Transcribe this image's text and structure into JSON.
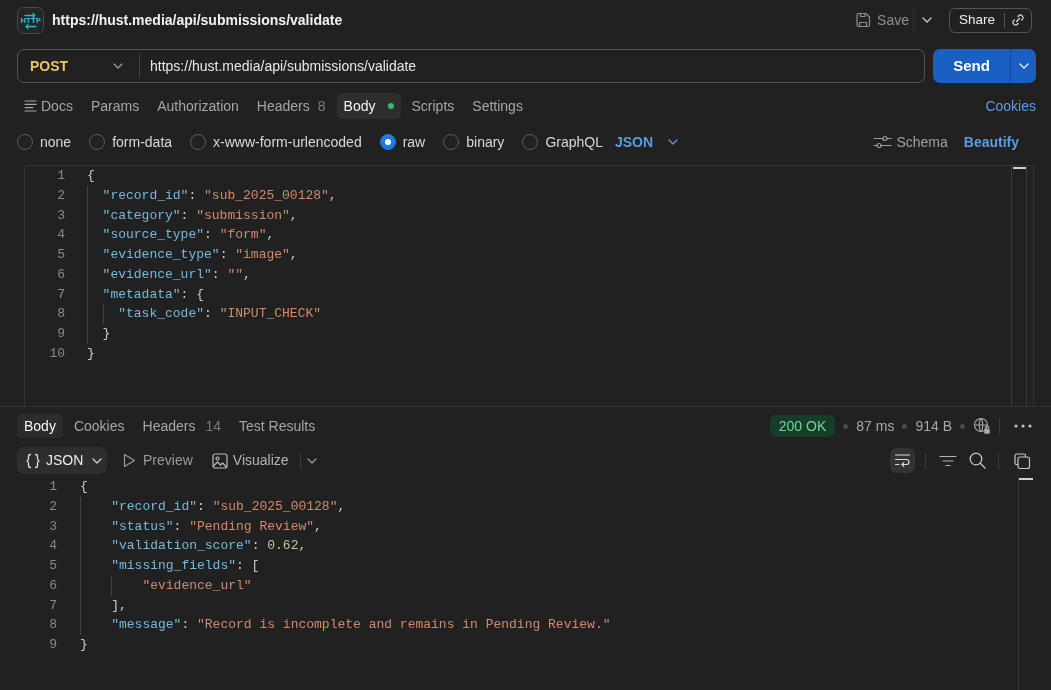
{
  "title_bar": {
    "icon_label": "HTTP",
    "title": "https://hust.media/api/submissions/validate",
    "save_label": "Save",
    "share_label": "Share"
  },
  "request": {
    "method": "POST",
    "url": "https://hust.media/api/submissions/validate",
    "send_label": "Send"
  },
  "request_tabs": [
    {
      "label": "Docs",
      "kind": "docs",
      "selected": false,
      "indicator": false
    },
    {
      "label": "Params",
      "kind": "plain",
      "selected": false,
      "indicator": false
    },
    {
      "label": "Authorization",
      "kind": "plain",
      "selected": false,
      "indicator": false
    },
    {
      "label": "Headers",
      "kind": "plain",
      "count": "8",
      "selected": false,
      "indicator": false
    },
    {
      "label": "Body",
      "kind": "plain",
      "selected": true,
      "indicator": true
    },
    {
      "label": "Scripts",
      "kind": "plain",
      "selected": false,
      "indicator": false
    },
    {
      "label": "Settings",
      "kind": "plain",
      "selected": false,
      "indicator": false
    }
  ],
  "cookies_link": "Cookies",
  "body_types": [
    {
      "label": "none",
      "selected": false
    },
    {
      "label": "form-data",
      "selected": false
    },
    {
      "label": "x-www-form-urlencoded",
      "selected": false
    },
    {
      "label": "raw",
      "selected": true
    },
    {
      "label": "binary",
      "selected": false
    },
    {
      "label": "GraphQL",
      "selected": false
    }
  ],
  "body_format": "JSON",
  "schema_label": "Schema",
  "beautify_label": "Beautify",
  "request_body": [
    {
      "number": "1",
      "tokens": [
        {
          "kind": "punct",
          "text": "{"
        }
      ],
      "children": [
        {
          "number": "2",
          "tokens": [
            {
              "kind": "key",
              "text": "\"record_id\""
            },
            {
              "kind": "punct",
              "text": ": "
            },
            {
              "kind": "string",
              "text": "\"sub_2025_00128\""
            },
            {
              "kind": "punct",
              "text": ","
            }
          ]
        },
        {
          "number": "3",
          "tokens": [
            {
              "kind": "key",
              "text": "\"category\""
            },
            {
              "kind": "punct",
              "text": ": "
            },
            {
              "kind": "string",
              "text": "\"submission\""
            },
            {
              "kind": "punct",
              "text": ","
            }
          ]
        },
        {
          "number": "4",
          "tokens": [
            {
              "kind": "key",
              "text": "\"source_type\""
            },
            {
              "kind": "punct",
              "text": ": "
            },
            {
              "kind": "string",
              "text": "\"form\""
            },
            {
              "kind": "punct",
              "text": ","
            }
          ]
        },
        {
          "number": "5",
          "tokens": [
            {
              "kind": "key",
              "text": "\"evidence_type\""
            },
            {
              "kind": "punct",
              "text": ": "
            },
            {
              "kind": "string",
              "text": "\"image\""
            },
            {
              "kind": "punct",
              "text": ","
            }
          ]
        },
        {
          "number": "6",
          "tokens": [
            {
              "kind": "key",
              "text": "\"evidence_url\""
            },
            {
              "kind": "punct",
              "text": ": "
            },
            {
              "kind": "string",
              "text": "\"\""
            },
            {
              "kind": "punct",
              "text": ","
            }
          ]
        },
        {
          "number": "7",
          "tokens": [
            {
              "kind": "key",
              "text": "\"metadata\""
            },
            {
              "kind": "punct",
              "text": ": {"
            }
          ],
          "children": [
            {
              "number": "8",
              "tokens": [
                {
                  "kind": "key",
                  "text": "\"task_code\""
                },
                {
                  "kind": "punct",
                  "text": ": "
                },
                {
                  "kind": "string",
                  "text": "\"INPUT_CHECK\""
                }
              ]
            }
          ]
        },
        {
          "number": "9",
          "tokens": [
            {
              "kind": "punct",
              "text": "}"
            }
          ]
        }
      ]
    },
    {
      "number": "10",
      "tokens": [
        {
          "kind": "punct",
          "text": "}"
        }
      ]
    }
  ],
  "response_tabs": [
    {
      "label": "Body",
      "selected": true
    },
    {
      "label": "Cookies",
      "selected": false
    },
    {
      "label": "Headers",
      "count": "14",
      "selected": false
    },
    {
      "label": "Test Results",
      "selected": false
    }
  ],
  "response_status": {
    "status": "200 OK",
    "time": "87 ms",
    "size": "914 B"
  },
  "response_view": {
    "format": "JSON",
    "preview_label": "Preview",
    "visualize_label": "Visualize",
    "line_wrap": true
  },
  "response_body": [
    {
      "number": "1",
      "tokens": [
        {
          "kind": "punct",
          "text": "{"
        }
      ],
      "children": [
        {
          "number": "2",
          "tokens": [
            {
              "kind": "key",
              "text": "\"record_id\""
            },
            {
              "kind": "punct",
              "text": ": "
            },
            {
              "kind": "string",
              "text": "\"sub_2025_00128\""
            },
            {
              "kind": "punct",
              "text": ","
            }
          ]
        },
        {
          "number": "3",
          "tokens": [
            {
              "kind": "key",
              "text": "\"status\""
            },
            {
              "kind": "punct",
              "text": ": "
            },
            {
              "kind": "string",
              "text": "\"Pending Review\""
            },
            {
              "kind": "punct",
              "text": ","
            }
          ]
        },
        {
          "number": "4",
          "tokens": [
            {
              "kind": "key",
              "text": "\"validation_score\""
            },
            {
              "kind": "punct",
              "text": ": "
            },
            {
              "kind": "number",
              "text": "0.62"
            },
            {
              "kind": "punct",
              "text": ","
            }
          ]
        },
        {
          "number": "5",
          "tokens": [
            {
              "kind": "key",
              "text": "\"missing_fields\""
            },
            {
              "kind": "punct",
              "text": ": ["
            }
          ],
          "children": [
            {
              "number": "6",
              "tokens": [
                {
                  "kind": "string",
                  "text": "\"evidence_url\""
                }
              ]
            }
          ]
        },
        {
          "number": "7",
          "tokens": [
            {
              "kind": "punct",
              "text": "],"
            }
          ]
        },
        {
          "number": "8",
          "tokens": [
            {
              "kind": "key",
              "text": "\"message\""
            },
            {
              "kind": "punct",
              "text": ": "
            },
            {
              "kind": "string",
              "text": "\"Record is incomplete and remains in Pending Review.\""
            }
          ]
        }
      ]
    },
    {
      "number": "9",
      "tokens": [
        {
          "kind": "punct",
          "text": "}"
        }
      ]
    }
  ]
}
